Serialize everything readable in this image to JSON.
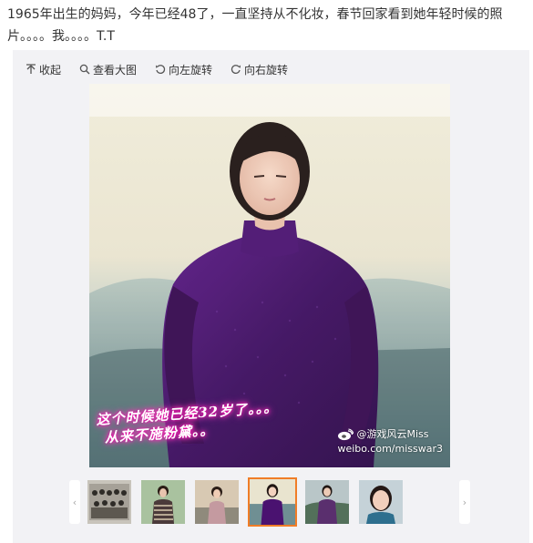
{
  "post": {
    "text": "1965年出生的妈妈，今年已经48了，一直坚持从不化妆，春节回家看到她年轻时候的照片。。。。我。。。。T.T"
  },
  "toolbar": {
    "collapse_label": "收起",
    "view_large_label": "查看大图",
    "rotate_left_label": "向左旋转",
    "rotate_right_label": "向右旋转"
  },
  "photo": {
    "caption_line1": "这个时候她已经32岁了。。。",
    "caption_line2": "从来不施粉黛。。",
    "watermark_user": "@游戏风云Miss",
    "watermark_url": "weibo.com/misswar3"
  },
  "thumbnails": {
    "prev_arrow": "‹",
    "next_arrow": "›",
    "active_index": 3,
    "count": 6
  },
  "colors": {
    "panel_bg": "#f2f2f5",
    "active_thumb_border": "#f07d27",
    "caption_glow": "#ff40c0",
    "dress": "#4a1270"
  }
}
